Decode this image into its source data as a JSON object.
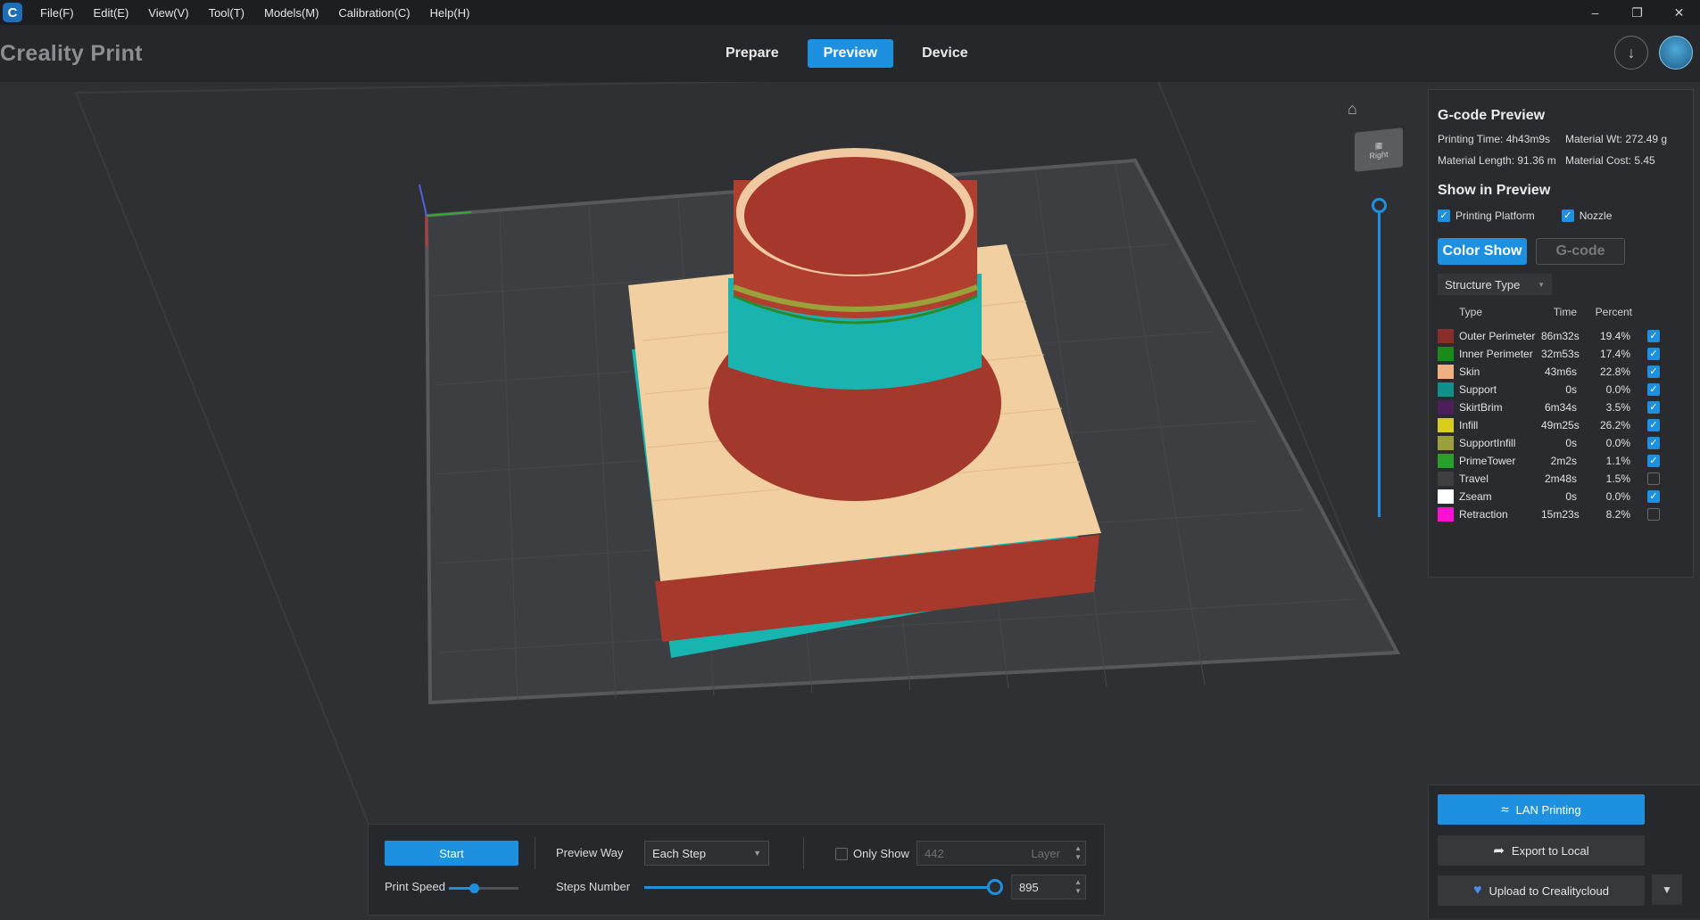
{
  "menu": {
    "logo": "C",
    "items": [
      "File(F)",
      "Edit(E)",
      "View(V)",
      "Tool(T)",
      "Models(M)",
      "Calibration(C)",
      "Help(H)"
    ]
  },
  "window_controls": [
    "minimize-icon",
    "restore-icon",
    "close-icon"
  ],
  "header": {
    "brand": "Creality Print",
    "tabs": [
      {
        "label": "Prepare",
        "active": false
      },
      {
        "label": "Preview",
        "active": true
      },
      {
        "label": "Device",
        "active": false
      }
    ]
  },
  "viewport": {
    "view_cube_label": "Right",
    "layer_slider_level": 1.0
  },
  "gcode_panel": {
    "title": "G-code Preview",
    "printing_time": "Printing Time: 4h43m9s",
    "material_wt": "Material Wt: 272.49 g",
    "material_length": "Material Length: 91.36 m",
    "material_cost": "Material Cost: 5.45",
    "show_title": "Show in Preview",
    "printing_platform": "Printing Platform",
    "nozzle": "Nozzle",
    "color_show": "Color Show",
    "gcode": "G-code",
    "structure_type": "Structure Type",
    "col_type": "Type",
    "col_time": "Time",
    "col_percent": "Percent",
    "legend": [
      {
        "name": "Outer Perimeter",
        "time": "86m32s",
        "percent": "19.4%",
        "color": "#8b2e2a",
        "checked": true
      },
      {
        "name": "Inner Perimeter",
        "time": "32m53s",
        "percent": "17.4%",
        "color": "#1b8a1b",
        "checked": true
      },
      {
        "name": "Skin",
        "time": "43m6s",
        "percent": "22.8%",
        "color": "#f0b080",
        "checked": true
      },
      {
        "name": "Support",
        "time": "0s",
        "percent": "0.0%",
        "color": "#11908a",
        "checked": true
      },
      {
        "name": "SkirtBrim",
        "time": "6m34s",
        "percent": "3.5%",
        "color": "#4a1f5a",
        "checked": true
      },
      {
        "name": "Infill",
        "time": "49m25s",
        "percent": "26.2%",
        "color": "#d8cc1c",
        "checked": true
      },
      {
        "name": "SupportInfill",
        "time": "0s",
        "percent": "0.0%",
        "color": "#9aa03a",
        "checked": true
      },
      {
        "name": "PrimeTower",
        "time": "2m2s",
        "percent": "1.1%",
        "color": "#2aa02a",
        "checked": true
      },
      {
        "name": "Travel",
        "time": "2m48s",
        "percent": "1.5%",
        "color": "#3f3f3f",
        "checked": false
      },
      {
        "name": "Zseam",
        "time": "0s",
        "percent": "0.0%",
        "color": "#ffffff",
        "checked": true
      },
      {
        "name": "Retraction",
        "time": "15m23s",
        "percent": "8.2%",
        "color": "#ff10d0",
        "checked": false
      }
    ]
  },
  "bottom_bar": {
    "start": "Start",
    "print_speed": "Print Speed",
    "print_speed_level": 0.36,
    "preview_way": "Preview Way",
    "preview_way_value": "Each Step",
    "only_show": "Only Show",
    "layer_value": "442",
    "layer_label": "Layer",
    "steps_number": "Steps Number",
    "steps_value": "895",
    "steps_level": 1.0
  },
  "export_panel": {
    "lan_printing": "LAN Printing",
    "export_local": "Export to Local",
    "upload": "Upload to Crealitycloud"
  }
}
